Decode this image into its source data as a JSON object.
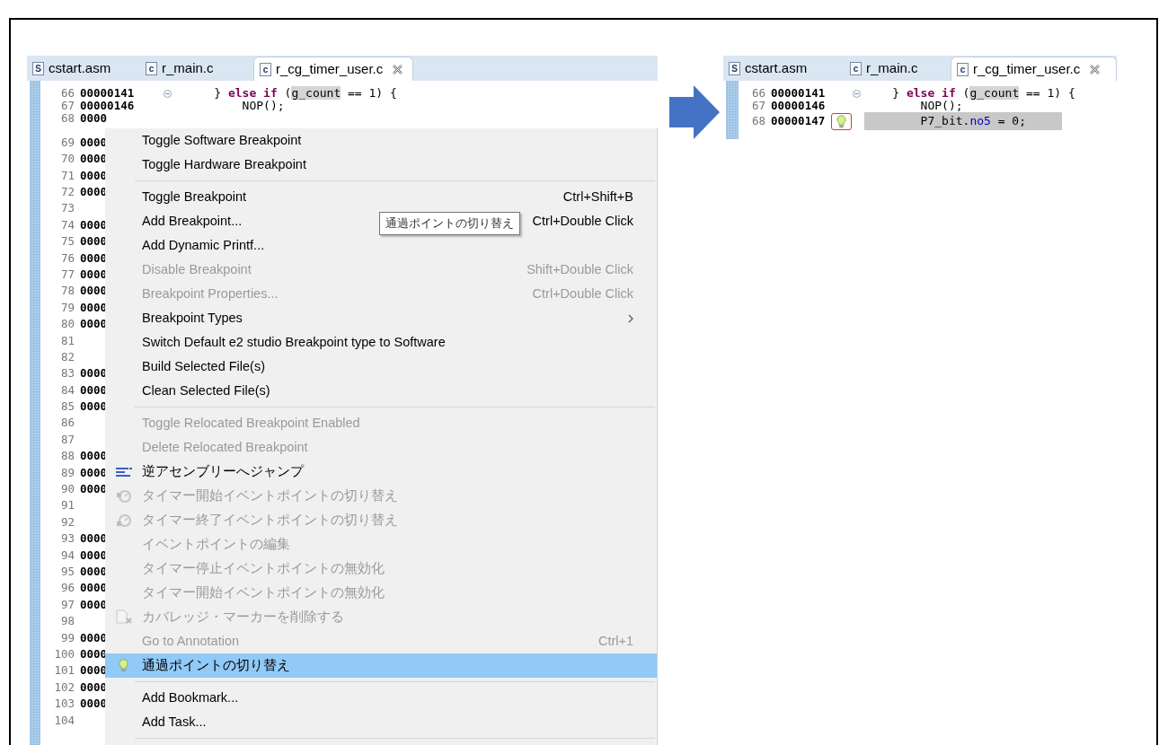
{
  "editors": [
    {
      "tabs": [
        {
          "label": "cstart.asm",
          "icon_text": "S",
          "selected": false,
          "closable": false
        },
        {
          "label": "r_main.c",
          "icon_text": "c",
          "selected": false,
          "closable": false
        },
        {
          "label": "r_cg_timer_user.c",
          "icon_text": "c",
          "selected": true,
          "closable": true
        }
      ],
      "lines": [
        {
          "number": "66",
          "address": "00000141",
          "fold": true,
          "code": [
            {
              "text": "    } ",
              "kind": "plain"
            },
            {
              "text": "else",
              "kind": "keyword"
            },
            {
              "text": " if",
              "kind": "keyword"
            },
            {
              "text": " (",
              "kind": "plain"
            },
            {
              "text": "g_count",
              "kind": "occurrence"
            },
            {
              "text": " == 1) {",
              "kind": "plain"
            }
          ]
        },
        {
          "number": "67",
          "address": "00000146",
          "code": [
            {
              "text": "        NOP();",
              "kind": "plain"
            }
          ]
        },
        {
          "number": "68",
          "address": "0000"
        },
        {
          "number": "69",
          "address": "0000"
        },
        {
          "number": "70",
          "address": "0000"
        },
        {
          "number": "71",
          "address": "0000"
        },
        {
          "number": "72",
          "address": "0000"
        },
        {
          "number": "73"
        },
        {
          "number": "74",
          "address": "0000"
        },
        {
          "number": "75",
          "address": "0000"
        },
        {
          "number": "76",
          "address": "0000"
        },
        {
          "number": "77",
          "address": "0000"
        },
        {
          "number": "78",
          "address": "0000"
        },
        {
          "number": "79",
          "address": "0000"
        },
        {
          "number": "80",
          "address": "0000"
        },
        {
          "number": "81"
        },
        {
          "number": "82"
        },
        {
          "number": "83",
          "address": "0000"
        },
        {
          "number": "84",
          "address": "0000"
        },
        {
          "number": "85",
          "address": "0000"
        },
        {
          "number": "86"
        },
        {
          "number": "87"
        },
        {
          "number": "88",
          "address": "0000"
        },
        {
          "number": "89",
          "address": "0000"
        },
        {
          "number": "90",
          "address": "0000"
        },
        {
          "number": "91"
        },
        {
          "number": "92"
        },
        {
          "number": "93",
          "address": "0000"
        },
        {
          "number": "94",
          "address": "0000"
        },
        {
          "number": "95",
          "address": "0000"
        },
        {
          "number": "96",
          "address": "0000"
        },
        {
          "number": "97",
          "address": "0000"
        },
        {
          "number": "98"
        },
        {
          "number": "99",
          "address": "0000"
        },
        {
          "number": "100",
          "address": "0000"
        },
        {
          "number": "101",
          "address": "0000"
        },
        {
          "number": "102",
          "address": "0000"
        },
        {
          "number": "103",
          "address": "0000"
        },
        {
          "number": "104"
        }
      ]
    },
    {
      "tabs": [
        {
          "label": "cstart.asm",
          "icon_text": "S",
          "selected": false,
          "closable": false
        },
        {
          "label": "r_main.c",
          "icon_text": "c",
          "selected": false,
          "closable": false
        },
        {
          "label": "r_cg_timer_user.c",
          "icon_text": "c",
          "selected": true,
          "closable": true
        }
      ],
      "lines": [
        {
          "number": "66",
          "address": "00000141",
          "fold": true,
          "code": [
            {
              "text": "    } ",
              "kind": "plain"
            },
            {
              "text": "else",
              "kind": "keyword"
            },
            {
              "text": " if",
              "kind": "keyword"
            },
            {
              "text": " (",
              "kind": "plain"
            },
            {
              "text": "g_count",
              "kind": "occurrence"
            },
            {
              "text": " == 1) {",
              "kind": "plain"
            }
          ]
        },
        {
          "number": "67",
          "address": "00000146",
          "code": [
            {
              "text": "        NOP();",
              "kind": "plain"
            }
          ]
        },
        {
          "number": "68",
          "address": "00000147",
          "highlighted": true,
          "passpoint": true,
          "code": [
            {
              "text": "        P7_bit.",
              "kind": "plain"
            },
            {
              "text": "no5",
              "kind": "field"
            },
            {
              "text": " = 0;",
              "kind": "plain"
            }
          ]
        }
      ]
    }
  ],
  "context_menu": {
    "items": [
      {
        "kind": "item",
        "label": "Toggle Software Breakpoint",
        "disabled": false,
        "selected": false
      },
      {
        "kind": "item",
        "label": "Toggle Hardware Breakpoint",
        "disabled": false,
        "selected": false
      },
      {
        "kind": "separator"
      },
      {
        "kind": "item",
        "label": "Toggle Breakpoint",
        "shortcut": "Ctrl+Shift+B",
        "disabled": false,
        "selected": false
      },
      {
        "kind": "item",
        "label": "Add Breakpoint...",
        "shortcut": "Ctrl+Double Click",
        "disabled": false,
        "selected": false
      },
      {
        "kind": "item",
        "label": "Add Dynamic Printf...",
        "disabled": false,
        "selected": false
      },
      {
        "kind": "item",
        "label": "Disable Breakpoint",
        "shortcut": "Shift+Double Click",
        "disabled": true,
        "selected": false
      },
      {
        "kind": "item",
        "label": "Breakpoint Properties...",
        "shortcut": "Ctrl+Double Click",
        "disabled": true,
        "selected": false
      },
      {
        "kind": "item",
        "label": "Breakpoint Types",
        "submenu": true,
        "disabled": false,
        "selected": false
      },
      {
        "kind": "item",
        "label": "Switch Default e2 studio Breakpoint type to Software",
        "disabled": false,
        "selected": false
      },
      {
        "kind": "item",
        "label": "Build Selected File(s)",
        "disabled": false,
        "selected": false
      },
      {
        "kind": "item",
        "label": "Clean Selected File(s)",
        "disabled": false,
        "selected": false
      },
      {
        "kind": "separator"
      },
      {
        "kind": "item",
        "label": "Toggle Relocated Breakpoint Enabled",
        "disabled": true,
        "selected": false
      },
      {
        "kind": "item",
        "label": "Delete Relocated Breakpoint",
        "disabled": true,
        "selected": false
      },
      {
        "kind": "item",
        "label": "逆アセンブリーへジャンプ",
        "disabled": false,
        "selected": false
      },
      {
        "kind": "item",
        "label": "タイマー開始イベントポイントの切り替え",
        "disabled": true,
        "selected": false
      },
      {
        "kind": "item",
        "label": "タイマー終了イベントポイントの切り替え",
        "disabled": true,
        "selected": false
      },
      {
        "kind": "item",
        "label": "イベントポイントの編集",
        "disabled": true,
        "selected": false
      },
      {
        "kind": "item",
        "label": "タイマー停止イベントポイントの無効化",
        "disabled": true,
        "selected": false
      },
      {
        "kind": "item",
        "label": "タイマー開始イベントポイントの無効化",
        "disabled": true,
        "selected": false
      },
      {
        "kind": "item",
        "label": "カバレッジ・マーカーを削除する",
        "disabled": true,
        "selected": false
      },
      {
        "kind": "item",
        "label": "Go to Annotation",
        "shortcut": "Ctrl+1",
        "disabled": true,
        "selected": false
      },
      {
        "kind": "item",
        "label": "通過ポイントの切り替え",
        "disabled": false,
        "selected": true
      },
      {
        "kind": "separator"
      },
      {
        "kind": "item",
        "label": "Add Bookmark...",
        "disabled": false,
        "selected": false
      },
      {
        "kind": "item",
        "label": "Add Task...",
        "disabled": false,
        "selected": false
      },
      {
        "kind": "separator"
      }
    ]
  },
  "tooltip": {
    "text": "通過ポイントの切り替え"
  }
}
